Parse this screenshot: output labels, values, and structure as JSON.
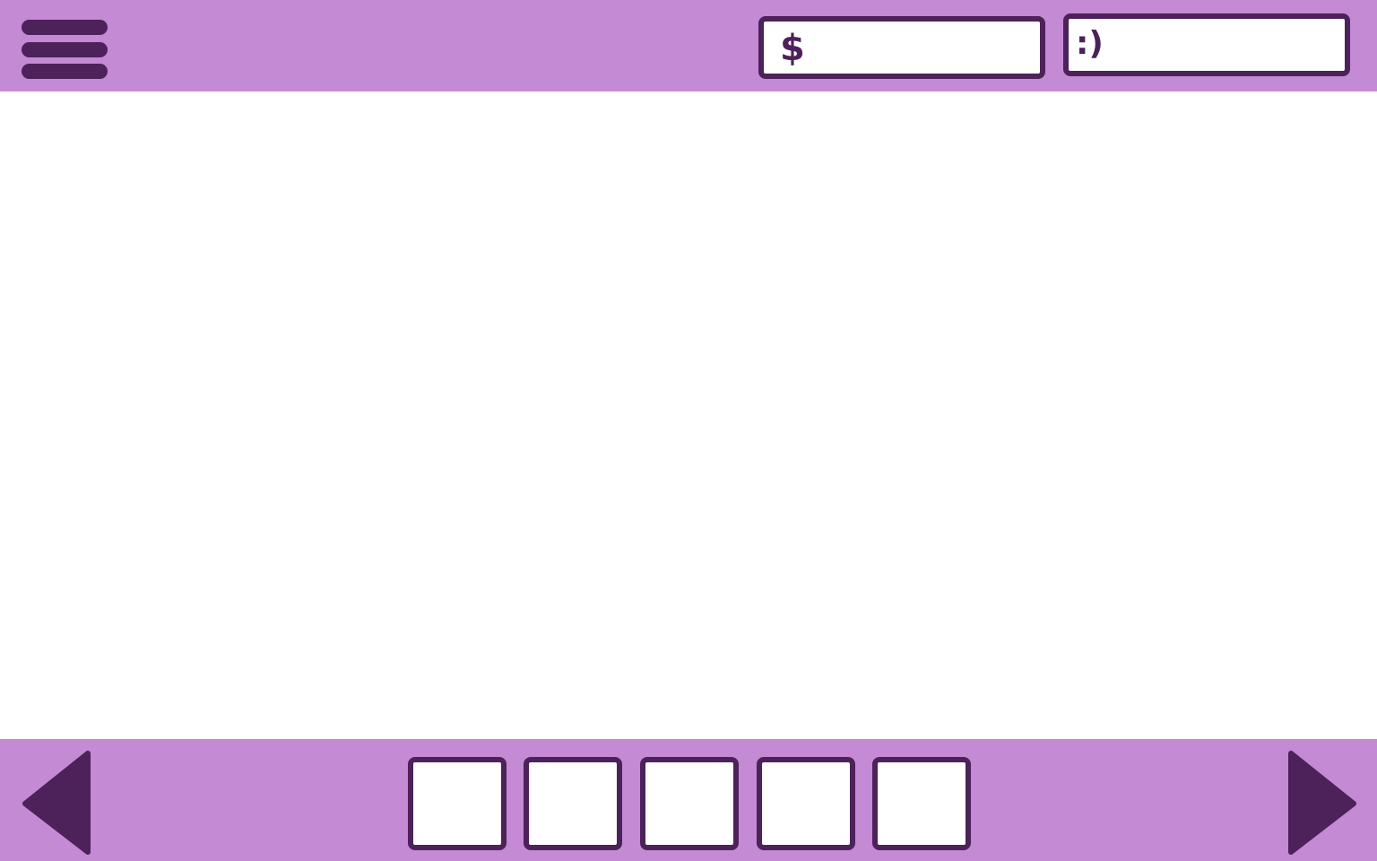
{
  "header": {
    "menu_icon": "hamburger-menu-icon",
    "money": {
      "symbol": "$",
      "value": ""
    },
    "mood": {
      "symbol": ":)",
      "value": ""
    }
  },
  "footer": {
    "prev_icon": "triangle-left-icon",
    "next_icon": "triangle-right-icon",
    "slots": [
      "",
      "",
      "",
      "",
      ""
    ]
  },
  "colors": {
    "bar_background": "#c48ad4",
    "accent_dark": "#4d2159",
    "content_background": "#ffffff"
  }
}
